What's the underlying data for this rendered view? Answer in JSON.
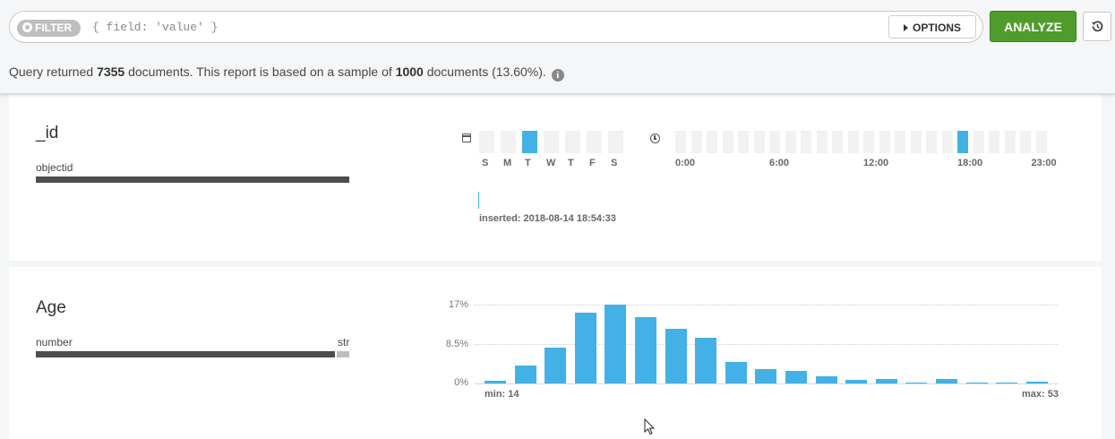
{
  "toolbar": {
    "filter_badge": "FILTER",
    "filter_placeholder": "{ field: 'value' }",
    "options_label": "OPTIONS",
    "analyze_label": "ANALYZE",
    "reset_icon": "history-icon"
  },
  "query": {
    "prefix": "Query returned ",
    "count": "7355",
    "middle": " documents. This report is based on a sample of ",
    "sample": "1000",
    "suffix": " documents (13.60%).",
    "info_icon": "info-icon",
    "info_glyph": "i"
  },
  "fields": [
    {
      "name": "_id",
      "types": [
        {
          "label": "objectid",
          "share": 1.0
        }
      ],
      "weekdays": [
        "S",
        "M",
        "T",
        "W",
        "T",
        "F",
        "S"
      ],
      "weekday_active": [
        2
      ],
      "hour_labels": [
        "0:00",
        "6:00",
        "12:00",
        "18:00",
        "23:00"
      ],
      "hour_active": [
        18
      ],
      "inserted": "inserted: 2018-08-14 18:54:33"
    },
    {
      "name": "Age",
      "types": [
        {
          "label": "number",
          "share": 0.95
        },
        {
          "label": "str",
          "share": 0.05
        }
      ],
      "chart_data": {
        "type": "bar",
        "values": [
          0.5,
          3.8,
          7.8,
          15.3,
          17.0,
          14.3,
          11.8,
          9.9,
          4.6,
          3.1,
          2.7,
          1.5,
          0.8,
          0.9,
          0.2,
          0.9,
          0.2,
          0.2,
          0.4
        ],
        "ylim": [
          0,
          17
        ],
        "y_ticks": [
          "17%",
          "8.5%",
          "0%"
        ],
        "min_label": "min: 14",
        "max_label": "max: 53"
      }
    }
  ],
  "colors": {
    "accent": "#43b1e5",
    "analyze": "#4f9c2c",
    "type_bar": "#4d4d4d"
  }
}
